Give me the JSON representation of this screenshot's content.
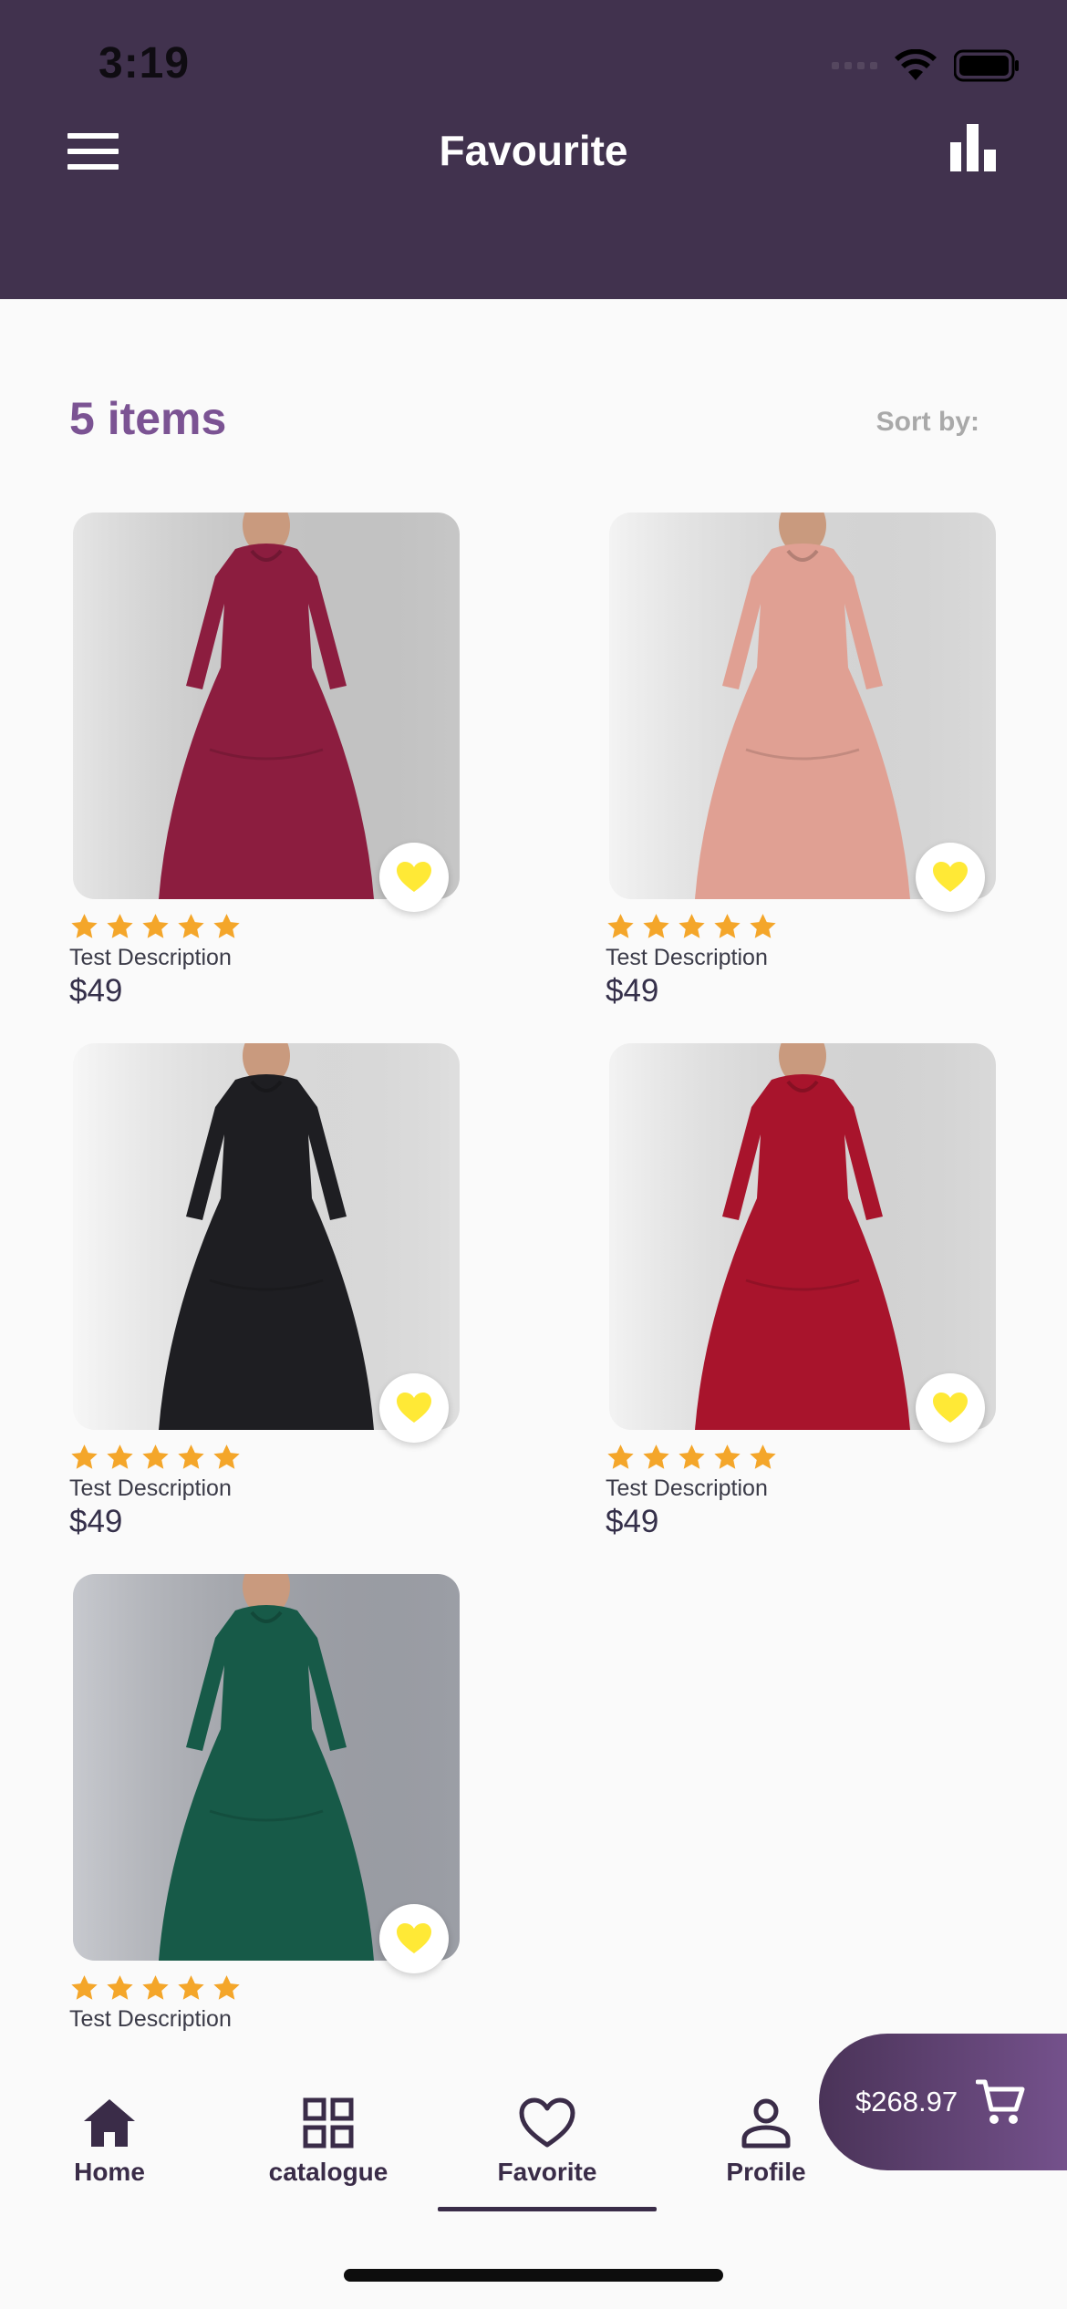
{
  "status_bar": {
    "time": "3:19"
  },
  "header": {
    "title": "Favourite",
    "menu_icon": "hamburger-menu-icon",
    "stats_icon": "bar-chart-icon",
    "background": "#41324e"
  },
  "summary": {
    "count_label": "5 items",
    "sort_label": "Sort by:"
  },
  "products": [
    {
      "description": "Test Description",
      "price": "$49",
      "rating": 5,
      "dress_color": "#8c1d3f",
      "favorite": true
    },
    {
      "description": "Test Description",
      "price": "$49",
      "rating": 5,
      "dress_color": "#e0a093",
      "favorite": true
    },
    {
      "description": "Test Description",
      "price": "$49",
      "rating": 5,
      "dress_color": "#1e1e22",
      "favorite": true
    },
    {
      "description": "Test Description",
      "price": "$49",
      "rating": 5,
      "dress_color": "#a8142c",
      "favorite": true
    },
    {
      "description": "Test Description",
      "price": "",
      "rating": 5,
      "dress_color": "#175a48",
      "favorite": true
    }
  ],
  "cart": {
    "total": "$268.97",
    "icon": "shopping-cart-icon"
  },
  "bottom_nav": [
    {
      "label": "Home",
      "icon": "home-icon"
    },
    {
      "label": "catalogue",
      "icon": "grid-icon"
    },
    {
      "label": "Favorite",
      "icon": "heart-outline-icon",
      "active": true
    },
    {
      "label": "Profile",
      "icon": "person-icon"
    }
  ],
  "colors": {
    "accent": "#7b5393",
    "star": "#f4a62a",
    "heart": "#ffe936"
  }
}
